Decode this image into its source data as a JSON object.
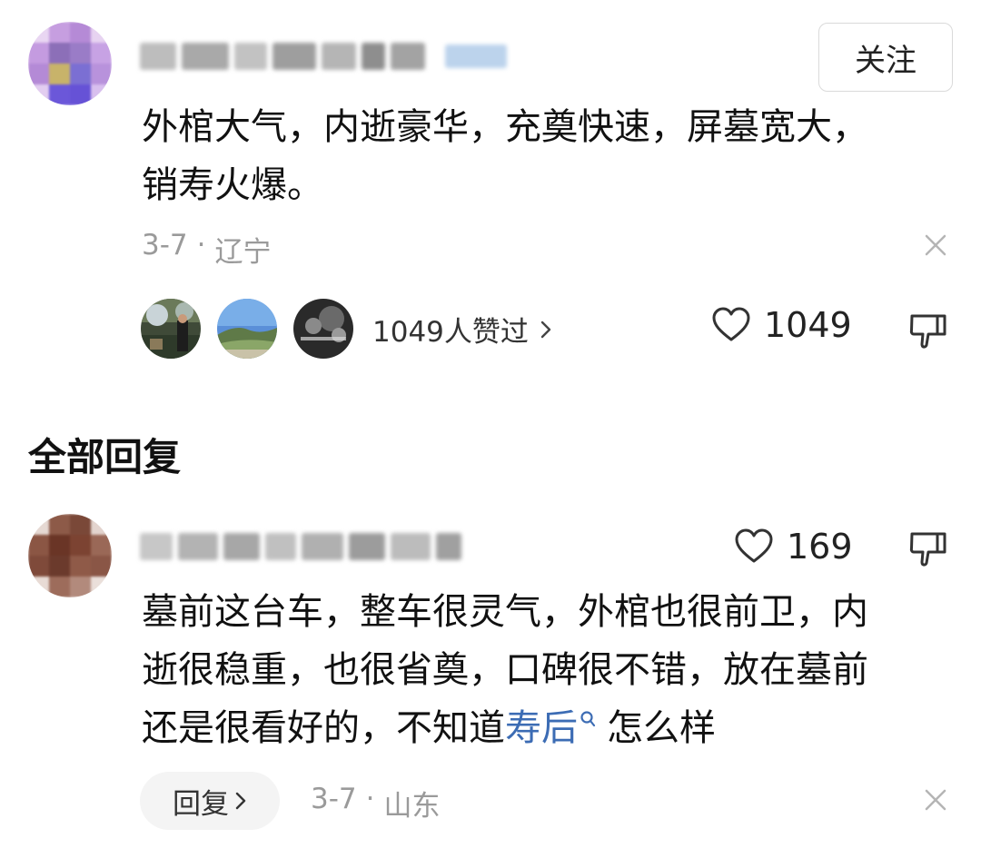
{
  "comment": {
    "follow_label": "关注",
    "text_line1": "外棺大气，内逝豪华，充奠快速，屏墓宽大，",
    "text_line2": "销寿火爆。",
    "date": "3-7",
    "dot": "·",
    "location": "辽宁",
    "likers_summary": "1049人赞过",
    "likes": "1049"
  },
  "section_title": "全部回复",
  "reply": {
    "likes": "169",
    "text_line1": "墓前这台车，整车很灵气，外棺也很前卫，内",
    "text_line2": "逝很稳重，也很省奠，口碑很不错，放在墓前",
    "text_line3_before": "还是很看好的，不知道",
    "text_line3_link": "寿后",
    "text_line3_after": "怎么样",
    "reply_button": "回复",
    "date": "3-7",
    "dot": "·",
    "location": "山东"
  },
  "icons": [
    "close-icon",
    "heart-icon",
    "dislike-icon",
    "search-icon",
    "chevron-right-icon"
  ],
  "colors": {
    "link": "#3c6cb4",
    "meta": "#9a9a9a",
    "pill_bg": "#f4f4f4"
  }
}
